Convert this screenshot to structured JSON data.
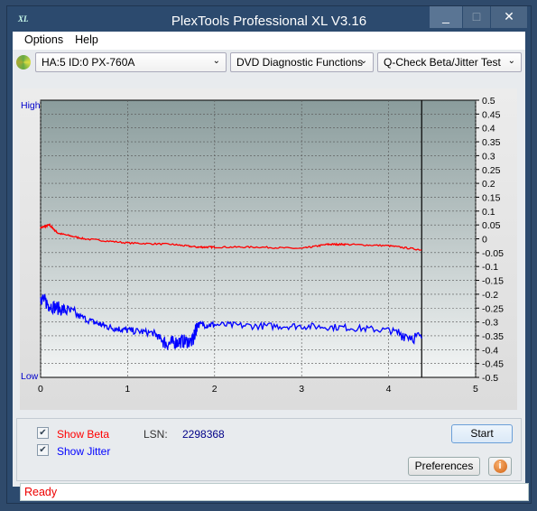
{
  "window": {
    "title": "PlexTools Professional XL V3.16",
    "logo": "XL"
  },
  "menu": {
    "items": [
      "Options",
      "Help"
    ]
  },
  "toolbar": {
    "drive": "HA:5 ID:0  PX-760A",
    "function": "DVD Diagnostic Functions",
    "test": "Q-Check Beta/Jitter Test"
  },
  "chart_data": {
    "type": "line",
    "xlim": [
      0,
      5
    ],
    "ylim": [
      -0.5,
      0.5
    ],
    "x_ticks": [
      "0",
      "1",
      "2",
      "3",
      "4",
      "5"
    ],
    "y_ticks": [
      "0.5",
      "0.45",
      "0.4",
      "0.35",
      "0.3",
      "0.25",
      "0.2",
      "0.15",
      "0.1",
      "0.05",
      "0",
      "-0.05",
      "-0.1",
      "-0.15",
      "-0.2",
      "-0.25",
      "-0.3",
      "-0.35",
      "-0.4",
      "-0.45",
      "-0.5"
    ],
    "left_labels": {
      "top": "High",
      "bottom": "Low"
    },
    "grid": true,
    "cursor_x": 4.38,
    "series": [
      {
        "key": "beta",
        "color": "#ff0000",
        "x": [
          0,
          0.1,
          0.2,
          0.5,
          1,
          1.5,
          1.8,
          2,
          2.5,
          3,
          3.3,
          3.5,
          4,
          4.38
        ],
        "y": [
          0.04,
          0.05,
          0.02,
          0.0,
          -0.015,
          -0.02,
          -0.03,
          -0.03,
          -0.03,
          -0.035,
          -0.02,
          -0.02,
          -0.025,
          -0.04
        ]
      },
      {
        "key": "jitter",
        "color": "#0000ff",
        "x": [
          0,
          0.1,
          0.3,
          0.6,
          0.8,
          1,
          1.3,
          1.45,
          1.6,
          1.75,
          1.8,
          2,
          2.5,
          3,
          3.5,
          4,
          4.38
        ],
        "y": [
          -0.21,
          -0.24,
          -0.26,
          -0.3,
          -0.32,
          -0.33,
          -0.34,
          -0.38,
          -0.37,
          -0.37,
          -0.31,
          -0.31,
          -0.315,
          -0.315,
          -0.32,
          -0.33,
          -0.36
        ]
      }
    ]
  },
  "controls": {
    "show_beta": "Show Beta",
    "show_jitter": "Show Jitter",
    "lsn_label": "LSN:",
    "lsn_value": "2298368",
    "start": "Start",
    "preferences": "Preferences",
    "beta_checked": true,
    "jitter_checked": true
  },
  "status": "Ready"
}
